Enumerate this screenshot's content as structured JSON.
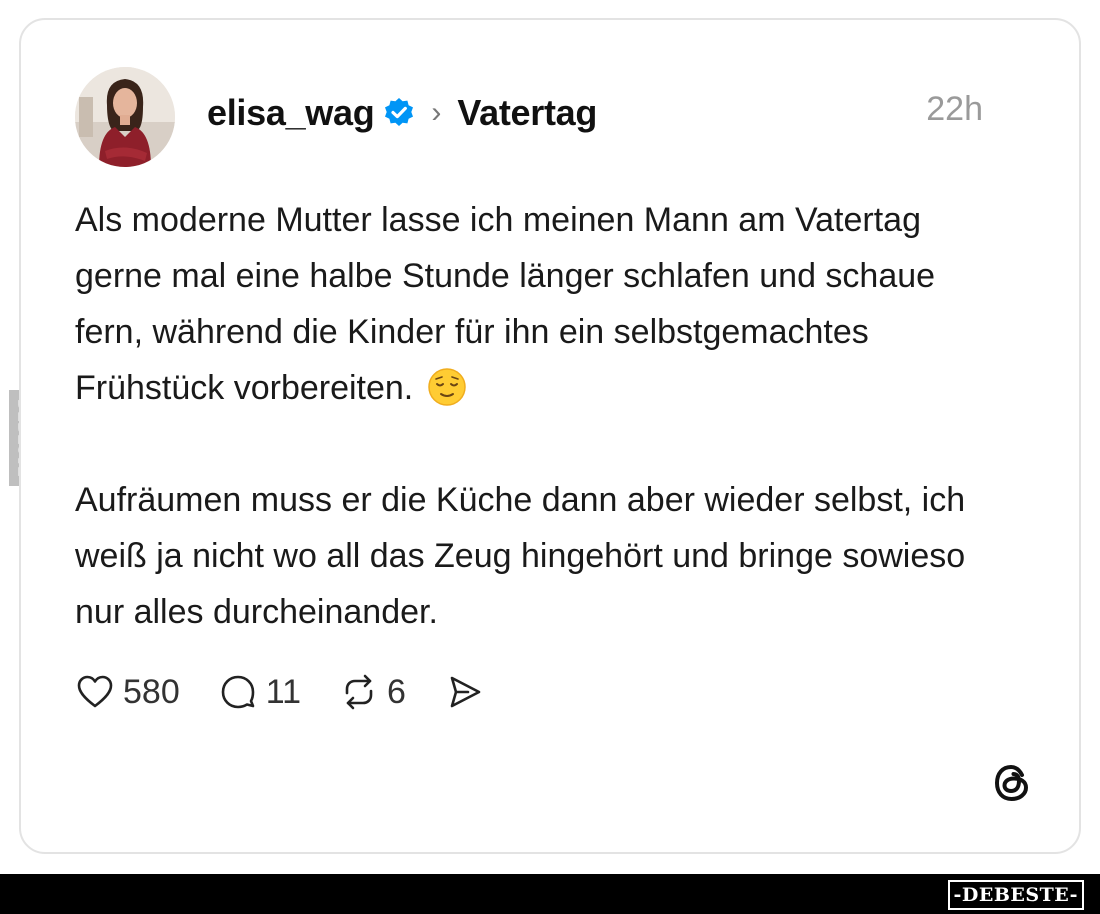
{
  "post": {
    "username": "elisa_wag",
    "topic": "Vatertag",
    "time": "22h",
    "paragraph1": "Als moderne Mutter lasse ich meinen Mann am Vatertag gerne mal eine halbe Stunde länger schlafen und schaue fern, während die Kinder für ihn ein selbstgemachtes Frühstück vorbereiten.",
    "paragraph2": "Aufräumen muss er die Küche dann aber wieder selbst, ich weiß ja nicht wo all das Zeug hingehört und bringe sowieso nur alles durcheinander.",
    "emoji_icon": "relieved-face-emoji"
  },
  "actions": {
    "likes": "580",
    "comments": "11",
    "reposts": "6",
    "icons": [
      "heart-icon",
      "comment-icon",
      "repost-icon",
      "share-icon"
    ]
  },
  "watermark": {
    "side": "DEBESTE",
    "brand": "-DEBESTE-"
  },
  "colors": {
    "verified_blue": "#0095f6",
    "muted_text": "#9a9a9a",
    "border": "#e3e3e3"
  }
}
